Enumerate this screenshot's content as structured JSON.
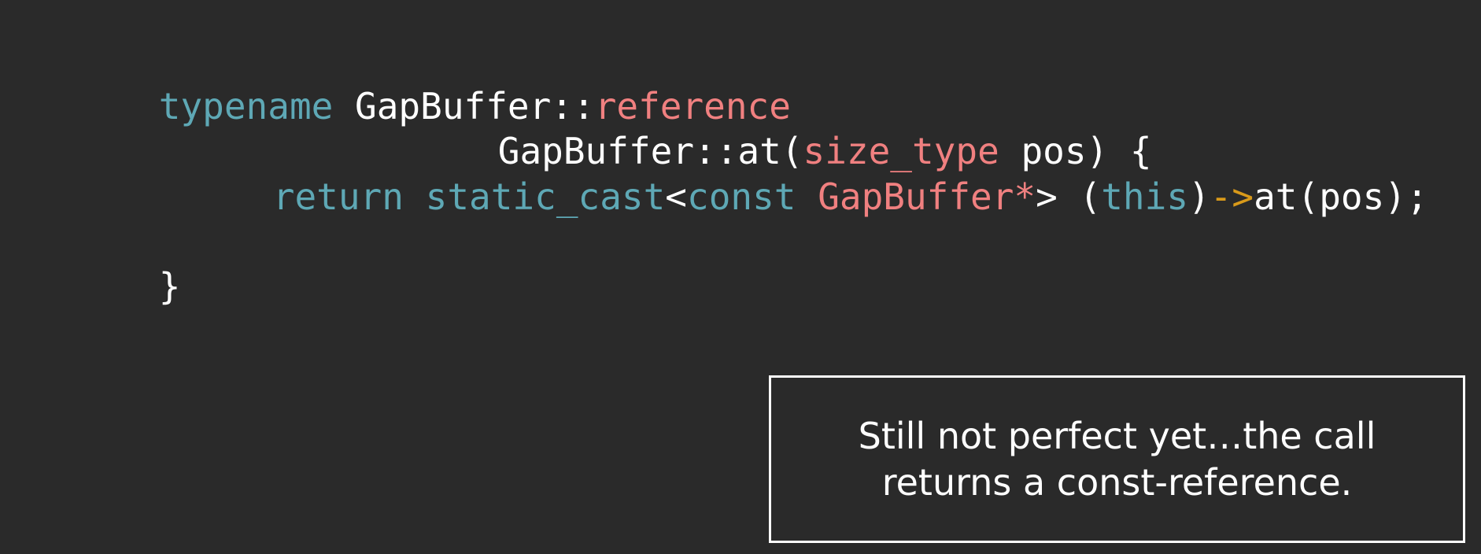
{
  "colors": {
    "background": "#2a2a2a",
    "keyword": "#5ea8b5",
    "type_highlight": "#f08080",
    "plain": "#ffffff",
    "arrow": "#d99a1a"
  },
  "code": {
    "lines": [
      {
        "tokens": [
          {
            "text": "typename",
            "color": "#5ea8b5"
          },
          {
            "text": " GapBuffer::",
            "color": "#ffffff"
          },
          {
            "text": "reference",
            "color": "#f08080"
          }
        ]
      },
      {
        "tokens": [
          {
            "text": "GapBuffer::at(",
            "color": "#ffffff"
          },
          {
            "text": "size_type",
            "color": "#f08080"
          },
          {
            "text": " pos) {",
            "color": "#ffffff"
          }
        ]
      },
      {
        "tokens": [
          {
            "text": "return",
            "color": "#5ea8b5"
          },
          {
            "text": " ",
            "color": "#ffffff"
          },
          {
            "text": "static_cast",
            "color": "#5ea8b5"
          },
          {
            "text": "<",
            "color": "#ffffff"
          },
          {
            "text": "const",
            "color": "#5ea8b5"
          },
          {
            "text": " ",
            "color": "#ffffff"
          },
          {
            "text": "GapBuffer*",
            "color": "#f08080"
          },
          {
            "text": "> (",
            "color": "#ffffff"
          },
          {
            "text": "this",
            "color": "#5ea8b5"
          },
          {
            "text": ")",
            "color": "#ffffff"
          },
          {
            "text": "->",
            "color": "#d99a1a"
          },
          {
            "text": "at(pos);",
            "color": "#ffffff"
          }
        ]
      },
      {
        "tokens": [
          {
            "text": "}",
            "color": "#ffffff"
          }
        ]
      }
    ]
  },
  "note": {
    "text": "Still not perfect yet…the call returns a const-reference."
  }
}
